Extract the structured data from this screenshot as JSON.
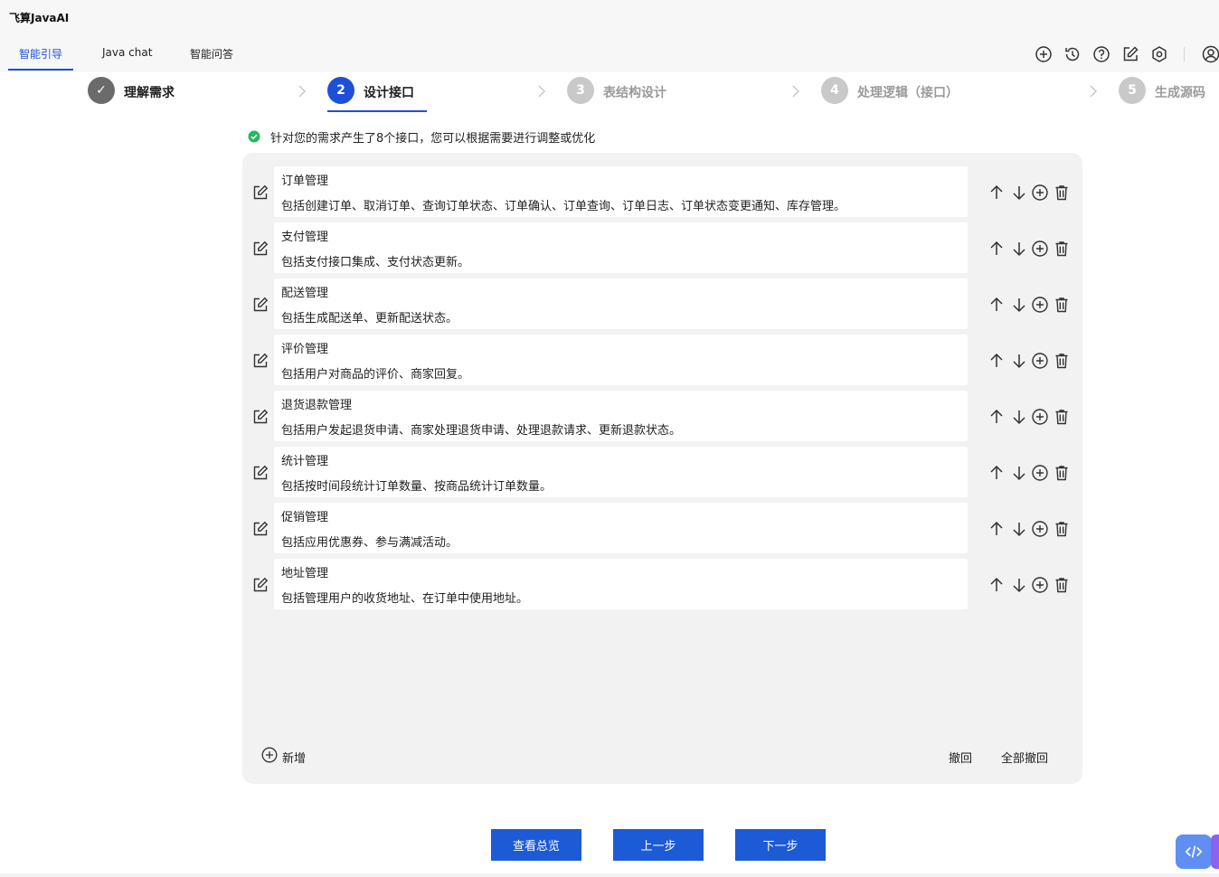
{
  "app": {
    "title": "飞算JavaAI"
  },
  "tabs": [
    {
      "label": "智能引导"
    },
    {
      "label": "Java chat"
    },
    {
      "label": "智能问答"
    }
  ],
  "toolbar_icons": [
    "plus-circle-icon",
    "history-icon",
    "help-icon",
    "edit-icon",
    "settings-icon",
    "user-icon"
  ],
  "steps": [
    {
      "number": "✓",
      "label": "理解需求",
      "state": "done"
    },
    {
      "number": "2",
      "label": "设计接口",
      "state": "active"
    },
    {
      "number": "3",
      "label": "表结构设计",
      "state": "todo"
    },
    {
      "number": "4",
      "label": "处理逻辑（接口）",
      "state": "todo"
    },
    {
      "number": "5",
      "label": "生成源码",
      "state": "todo"
    }
  ],
  "notice": {
    "text": "针对您的需求产生了8个接口，您可以根据需要进行调整或优化",
    "icon": "check-circle-icon",
    "color": "#25b864"
  },
  "interfaces": [
    {
      "title": "订单管理",
      "desc": "包括创建订单、取消订单、查询订单状态、订单确认、订单查询、订单日志、订单状态变更通知、库存管理。"
    },
    {
      "title": "支付管理",
      "desc": "包括支付接口集成、支付状态更新。"
    },
    {
      "title": "配送管理",
      "desc": "包括生成配送单、更新配送状态。"
    },
    {
      "title": "评价管理",
      "desc": "包括用户对商品的评价、商家回复。"
    },
    {
      "title": "退货退款管理",
      "desc": "包括用户发起退货申请、商家处理退货申请、处理退款请求、更新退款状态。"
    },
    {
      "title": "统计管理",
      "desc": "包括按时间段统计订单数量、按商品统计订单数量。"
    },
    {
      "title": "促销管理",
      "desc": "包括应用优惠券、参与满减活动。"
    },
    {
      "title": "地址管理",
      "desc": "包括管理用户的收货地址、在订单中使用地址。"
    }
  ],
  "panel_footer": {
    "add_label": "新增",
    "undo_label": "撤回",
    "undo_all_label": "全部撤回"
  },
  "buttons": {
    "overview": "查看总览",
    "prev": "上一步",
    "next": "下一步"
  },
  "colors": {
    "accent": "#1d4fd8",
    "button": "#1d5ad6",
    "success": "#25b864"
  }
}
